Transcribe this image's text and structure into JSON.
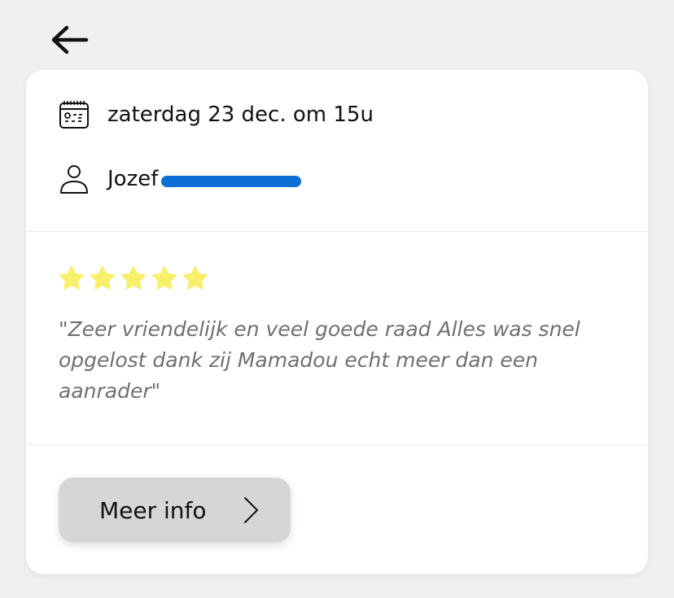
{
  "header": {
    "back_icon": "arrow-left-icon"
  },
  "appointment": {
    "date_icon": "calendar-icon",
    "date_text": "zaterdag 23 dec. om 15u",
    "person_icon": "user-icon",
    "person_name": "Jozef"
  },
  "review": {
    "rating": 5,
    "max_rating": 5,
    "star_icon": "star-icon",
    "star_color": "#f7f06a",
    "text": "\"Zeer vriendelijk en veel goede raad Alles was snel opgelost dank zij Mamadou echt meer dan een aanrader\""
  },
  "actions": {
    "more_info_label": "Meer info",
    "more_info_icon": "chevron-right-icon"
  },
  "colors": {
    "background": "#f0f0f0",
    "card": "#ffffff",
    "button": "#d6d6d6",
    "redaction": "#0a6fd4",
    "review_text": "#6f6f6f"
  }
}
